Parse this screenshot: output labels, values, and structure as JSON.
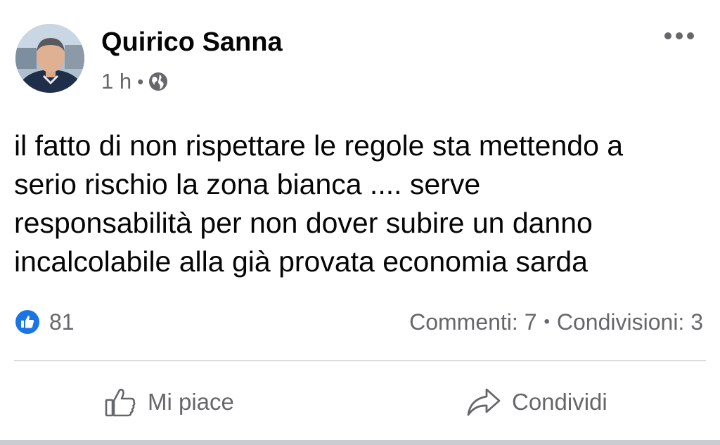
{
  "post": {
    "author": "Quirico Sanna",
    "time": "1 h",
    "separator": "•",
    "privacy_icon": "globe-icon",
    "menu_icon": "more-options-icon",
    "text": "il fatto di non rispettare le regole sta mettendo a\nserio rischio la zona bianca .... serve\nresponsabilità per non dover subire un danno\nincalcolabile alla già provata economia sarda"
  },
  "reactions": {
    "icon": "like-reaction-icon",
    "count": "81"
  },
  "stats": {
    "comments": "Commenti: 7",
    "separator": "•",
    "shares": "Condivisioni: 3"
  },
  "actions": {
    "like_label": "Mi piace",
    "like_icon": "thumbs-up-icon",
    "share_label": "Condividi",
    "share_icon": "share-arrow-icon"
  },
  "colors": {
    "like_blue": "#1b74e4",
    "secondary_text": "#65676b",
    "primary_text": "#050505",
    "divider": "#dadde1"
  }
}
